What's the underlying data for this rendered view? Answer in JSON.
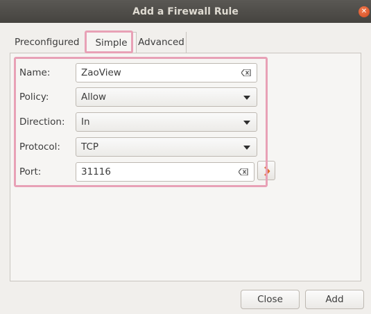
{
  "window": {
    "title": "Add a Firewall Rule"
  },
  "tabs": [
    {
      "label": "Preconfigured"
    },
    {
      "label": "Simple"
    },
    {
      "label": "Advanced"
    }
  ],
  "form": {
    "name": {
      "label": "Name:",
      "value": "ZaoView"
    },
    "policy": {
      "label": "Policy:",
      "value": "Allow"
    },
    "direction": {
      "label": "Direction:",
      "value": "In"
    },
    "protocol": {
      "label": "Protocol:",
      "value": "TCP"
    },
    "port": {
      "label": "Port:",
      "value": "31116"
    }
  },
  "buttons": {
    "close": "Close",
    "add": "Add"
  },
  "colors": {
    "highlight": "#e8a1b6",
    "accent": "#e06b2c"
  }
}
